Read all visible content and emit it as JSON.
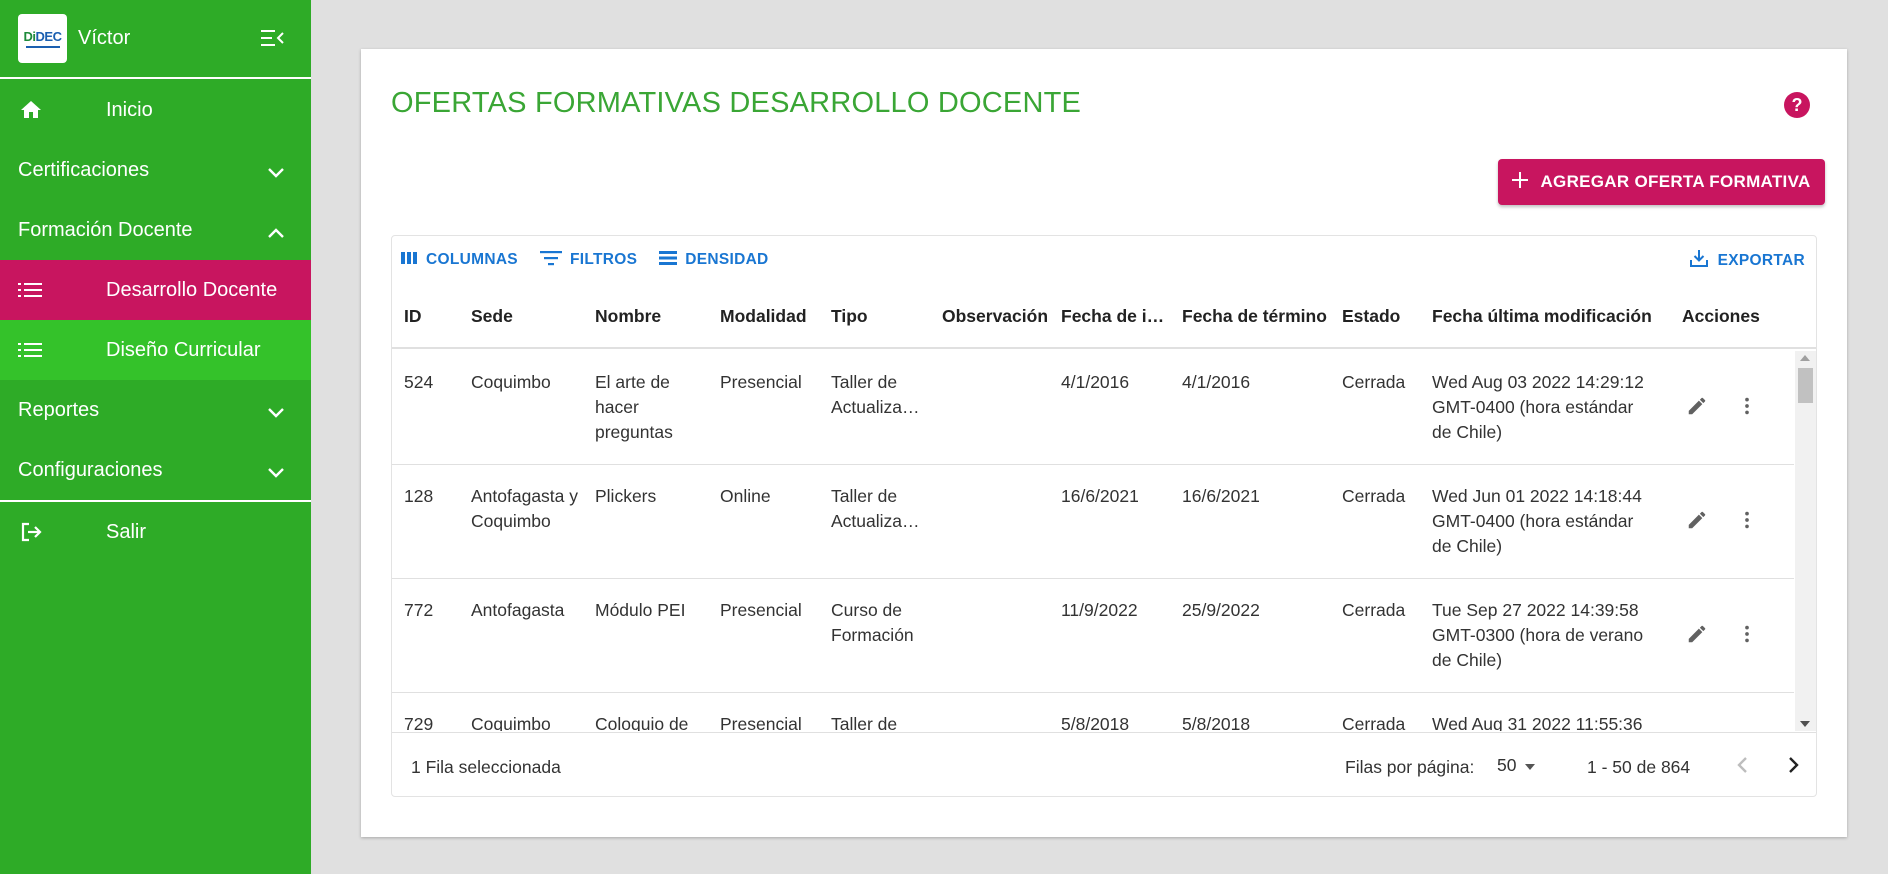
{
  "sidebar": {
    "logo_text_green": "Di",
    "logo_text_blue": "DEC",
    "username": "Víctor",
    "items": [
      {
        "label": "Inicio"
      },
      {
        "label": "Certificaciones"
      },
      {
        "label": "Formación Docente"
      },
      {
        "label": "Desarrollo Docente"
      },
      {
        "label": "Diseño Curricular"
      },
      {
        "label": "Reportes"
      },
      {
        "label": "Configuraciones"
      },
      {
        "label": "Salir"
      }
    ]
  },
  "page": {
    "title": "OFERTAS FORMATIVAS DESARROLLO DOCENTE",
    "add_button": "AGREGAR OFERTA FORMATIVA"
  },
  "toolbar": {
    "columns": "COLUMNAS",
    "filters": "FILTROS",
    "density": "DENSIDAD",
    "export": "EXPORTAR"
  },
  "table": {
    "headers": {
      "id": "ID",
      "sede": "Sede",
      "nombre": "Nombre",
      "modalidad": "Modalidad",
      "tipo": "Tipo",
      "observacion": "Observación",
      "fecha_inicio": "Fecha de inicio",
      "fecha_termino": "Fecha de término",
      "estado": "Estado",
      "fecha_mod": "Fecha última modificación",
      "acciones": "Acciones"
    },
    "rows": [
      {
        "id": "524",
        "sede": "Coquimbo",
        "nombre": "El arte de hacer preguntas",
        "modalidad": "Presencial",
        "tipo": "Taller de Actualiza…",
        "observacion": "",
        "fecha_inicio": "4/1/2016",
        "fecha_termino": "4/1/2016",
        "estado": "Cerrada",
        "fecha_mod": "Wed Aug 03 2022 14:29:12 GMT-0400 (hora estándar de Chile)"
      },
      {
        "id": "128",
        "sede": "Antofagasta y Coquimbo",
        "nombre": "Plickers",
        "modalidad": "Online",
        "tipo": "Taller de Actualiza…",
        "observacion": "",
        "fecha_inicio": "16/6/2021",
        "fecha_termino": "16/6/2021",
        "estado": "Cerrada",
        "fecha_mod": "Wed Jun 01 2022 14:18:44 GMT-0400 (hora estándar de Chile)"
      },
      {
        "id": "772",
        "sede": "Antofagasta",
        "nombre": "Módulo PEI",
        "modalidad": "Presencial",
        "tipo": "Curso de Formación",
        "observacion": "",
        "fecha_inicio": "11/9/2022",
        "fecha_termino": "25/9/2022",
        "estado": "Cerrada",
        "fecha_mod": "Tue Sep 27 2022 14:39:58 GMT-0300 (hora de verano de Chile)"
      },
      {
        "id": "729",
        "sede": "Coquimbo",
        "nombre": "Coloquio de",
        "modalidad": "Presencial",
        "tipo": "Taller de",
        "observacion": "",
        "fecha_inicio": "5/8/2018",
        "fecha_termino": "5/8/2018",
        "estado": "Cerrada",
        "fecha_mod": "Wed Aug 31 2022 11:55:36"
      }
    ]
  },
  "footer": {
    "selected": "1 Fila seleccionada",
    "rows_per_page_label": "Filas por página:",
    "rows_per_page_value": "50",
    "range": "1 - 50 de 864"
  },
  "colors": {
    "sidebar_green": "#2eab27",
    "active_magenta": "#c8155f",
    "title_green": "#3aa635",
    "link_blue": "#1976d2"
  }
}
